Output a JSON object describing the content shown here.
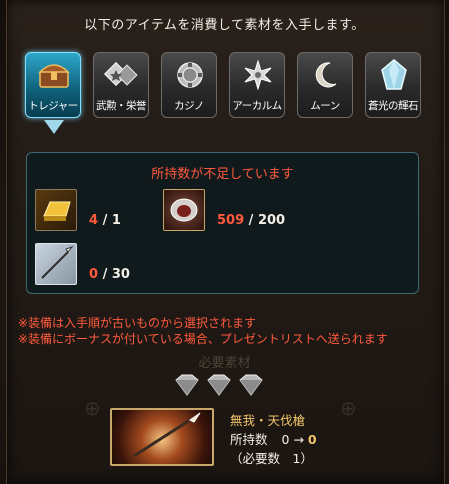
{
  "header": {
    "text": "以下のアイテムを消費して素材を入手します。"
  },
  "tabs": [
    {
      "label": "トレジャー",
      "icon": "treasure-chest-icon",
      "active": true
    },
    {
      "label": "武勲・栄誉",
      "icon": "medals-icon",
      "active": false
    },
    {
      "label": "カジノ",
      "icon": "casino-chip-icon",
      "active": false
    },
    {
      "label": "アーカルム",
      "icon": "arcarum-star-icon",
      "active": false
    },
    {
      "label": "ムーン",
      "icon": "moon-icon",
      "active": false
    },
    {
      "label": "蒼光の輝石",
      "icon": "crystal-icon",
      "active": false
    }
  ],
  "requirements": {
    "warning": "所持数が不足しています",
    "items": [
      {
        "icon": "gold-bar-icon",
        "have": "4",
        "need": "/ 1"
      },
      {
        "icon": "silver-orb-icon",
        "have": "509",
        "need": "/ 200"
      },
      {
        "icon": "spear-icon",
        "have": "0",
        "need": "/ 30"
      }
    ]
  },
  "notes": [
    "※装備は入手順が古いものから選択されます",
    "※装備にボーナスが付いている場合、プレゼントリストへ送られます"
  ],
  "material": {
    "section_label": "必要素材",
    "name": "無我・天伐槍",
    "owned_label": "所持数",
    "owned_from": "0",
    "arrow": "→",
    "owned_to": "0",
    "required_text": "（必要数　1）"
  },
  "colors": {
    "accent": "#2ea7c9",
    "warning": "#ff5a3c",
    "gold": "#f0c66c"
  }
}
